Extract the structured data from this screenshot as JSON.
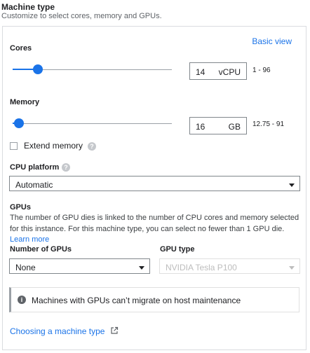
{
  "header": {
    "title": "Machine type",
    "subtitle": "Customize to select cores, memory and GPUs."
  },
  "basic_view_label": "Basic view",
  "cores": {
    "label": "Cores",
    "value": "14",
    "unit": "vCPU",
    "range": "1 - 96",
    "slider_fraction": 0.16
  },
  "memory": {
    "label": "Memory",
    "value": "16",
    "unit": "GB",
    "range": "12.75 - 91",
    "slider_fraction": 0.04
  },
  "extend_memory": {
    "label": "Extend memory",
    "checked": false,
    "help_icon": "help-icon"
  },
  "cpu_platform": {
    "label": "CPU platform",
    "selected": "Automatic",
    "help_icon": "help-icon"
  },
  "gpus": {
    "label": "GPUs",
    "description": "The number of GPU dies is linked to the number of CPU cores and memory selected for this instance. For this machine type, you can select no fewer than 1 GPU die.",
    "learn_more": "Learn more",
    "number_label": "Number of GPUs",
    "number_selected": "None",
    "type_label": "GPU type",
    "type_selected": "NVIDIA Tesla P100"
  },
  "notice": {
    "icon": "info-icon",
    "text": "Machines with GPUs can’t migrate on host maintenance"
  },
  "footer_link": {
    "label": "Choosing a machine type",
    "icon": "external-link-icon"
  },
  "colors": {
    "accent": "#1a73e8",
    "border": "#dadce0",
    "muted_text": "#5f6368"
  }
}
